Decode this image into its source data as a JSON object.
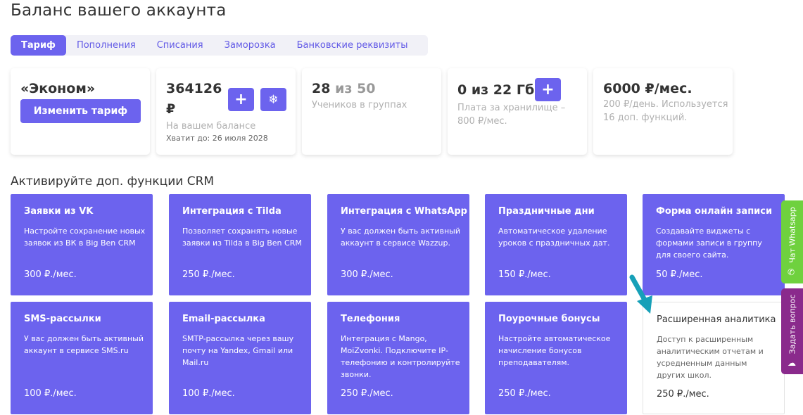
{
  "page": {
    "title": "Баланс вашего аккаунта"
  },
  "tabs": [
    {
      "label": "Тариф",
      "active": true
    },
    {
      "label": "Пополнения"
    },
    {
      "label": "Списания"
    },
    {
      "label": "Заморозка"
    },
    {
      "label": "Банковские реквизиты"
    }
  ],
  "summary": {
    "tariff": {
      "name": "«Эконом»",
      "button": "Изменить тариф"
    },
    "balance": {
      "amount": "364126",
      "currency": "₽",
      "label": "На вашем балансе",
      "until": "Хватит до: 26 июля 2028",
      "add_icon": "plus-icon",
      "freeze_icon": "snowflake-icon"
    },
    "students": {
      "count": "28",
      "separator": "из",
      "limit": "50",
      "label": "Учеников в группах"
    },
    "storage": {
      "value": "0 из 22 Гб",
      "label": "Плата за хранилище – 800 ₽/мес.",
      "add_icon": "plus-icon"
    },
    "monthly": {
      "value": "6000 ₽/мес.",
      "label": "200 ₽/день. Используется 16 доп. функций."
    }
  },
  "section": {
    "title": "Активируйте доп. функции CRM"
  },
  "features": [
    {
      "title": "Заявки из VK",
      "desc": "Настройте сохранение новых заявок из ВК в Big Ben CRM",
      "price": "300 ₽./мес."
    },
    {
      "title": "Интеграция с Tilda",
      "desc": "Позволяет сохранять новые заявки из Tilda в Big Ben CRM",
      "price": "250 ₽./мес."
    },
    {
      "title": "Интеграция с WhatsApp",
      "desc": "У вас должен быть активный аккаунт в сервисе Wazzup.",
      "price": "300 ₽./мес."
    },
    {
      "title": "Праздничные дни",
      "desc": "Автоматическое удаление уроков с праздничных дат.",
      "price": "150 ₽./мес."
    },
    {
      "title": "Форма онлайн записи",
      "desc": "Создавайте виджеты с формами записи в группу для своего сайта.",
      "price": "50 ₽./мес."
    },
    {
      "title": "SMS-рассылки",
      "desc": "У вас должен быть активный аккаунт в сервисе SMS.ru",
      "price": "100 ₽./мес."
    },
    {
      "title": "Email-рассылка",
      "desc": "SMTP-рассылка через вашу почту на Yandex, Gmail или Mail.ru",
      "price": "100 ₽./мес."
    },
    {
      "title": "Телефония",
      "desc": "Интеграция с Mango, MoiZvonki. Подключите IP-телефонию и контролируйте звонки.",
      "price": "250 ₽./мес."
    },
    {
      "title": "Поурочные бонусы",
      "desc": "Настройте автоматическое начисление бонусов преподавателям.",
      "price": "250 ₽./мес."
    },
    {
      "title": "Расширенная аналитика",
      "desc": "Доступ к расширенным аналитическим отчетам и усредненным данным других школ.",
      "price": "250 ₽./мес."
    }
  ],
  "side": {
    "whatsapp": {
      "label": "Чат Whatsapp",
      "color": "#6fd13e"
    },
    "question": {
      "label": "Задать вопрос",
      "color": "#8a2a8c"
    }
  },
  "colors": {
    "accent": "#6c63ee",
    "arrow": "#17a0b8"
  }
}
